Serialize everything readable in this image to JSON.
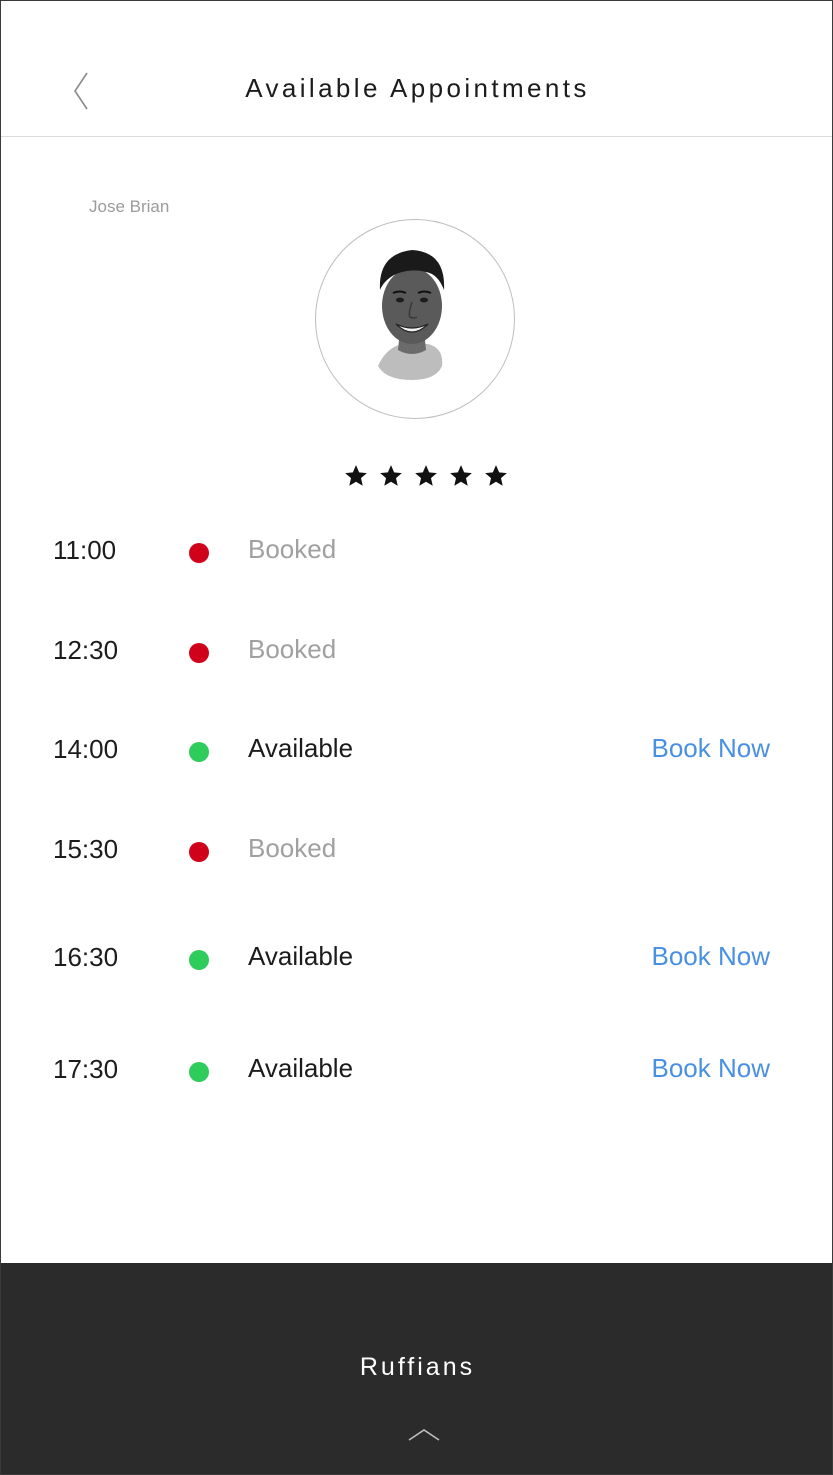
{
  "header": {
    "title": "Available Appointments",
    "back_icon": "chevron-left-icon"
  },
  "barber": {
    "name": "Jose Brian",
    "rating": 5,
    "rating_max": 5
  },
  "colors": {
    "booked": "#d0021b",
    "available": "#2ecc5a",
    "link": "#4a90e2",
    "booked_text": "#a0a0a0",
    "available_text": "#1c1c1c",
    "footer_bg": "#2b2b2b"
  },
  "slots": [
    {
      "time": "11:00",
      "status": "Booked",
      "available": false,
      "action": ""
    },
    {
      "time": "12:30",
      "status": "Booked",
      "available": false,
      "action": ""
    },
    {
      "time": "14:00",
      "status": "Available",
      "available": true,
      "action": "Book Now"
    },
    {
      "time": "15:30",
      "status": "Booked",
      "available": false,
      "action": ""
    },
    {
      "time": "16:30",
      "status": "Available",
      "available": true,
      "action": "Book Now"
    },
    {
      "time": "17:30",
      "status": "Available",
      "available": true,
      "action": "Book Now"
    }
  ],
  "footer": {
    "brand": "Ruffians",
    "expand_icon": "chevron-up-icon"
  }
}
